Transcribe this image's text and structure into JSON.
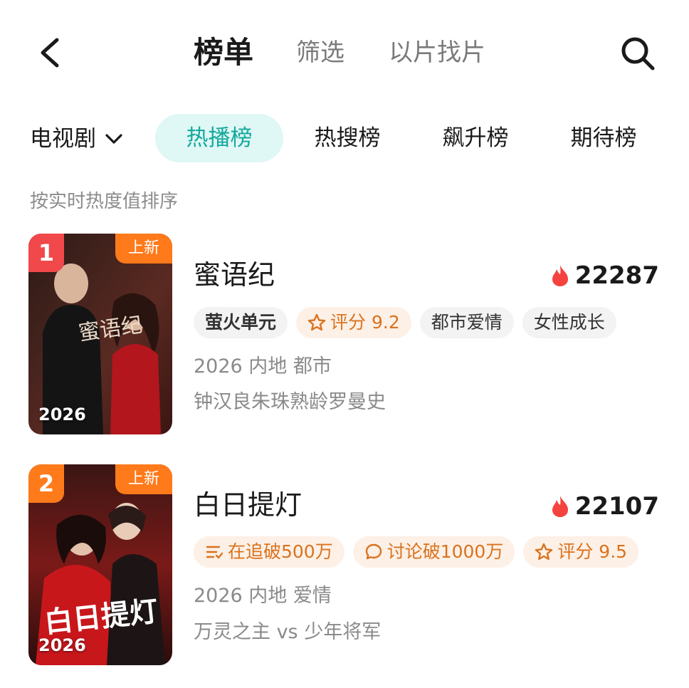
{
  "nav": {
    "tabs": [
      {
        "label": "榜单"
      },
      {
        "label": "筛选"
      },
      {
        "label": "以片找片"
      }
    ]
  },
  "category": {
    "selected": "电视剧",
    "tabs": [
      {
        "label": "热播榜"
      },
      {
        "label": "热搜榜"
      },
      {
        "label": "飙升榜"
      },
      {
        "label": "期待榜"
      }
    ]
  },
  "sort_hint": "按实时热度值排序",
  "items": [
    {
      "rank": "1",
      "badge": "上新",
      "poster_year": "2026",
      "poster_text": "蜜语纪",
      "title": "蜜语纪",
      "heat": "22287",
      "platform": "萤火单元",
      "tags": [
        "评分 9.2",
        "都市爱情",
        "女性成长"
      ],
      "meta": "2026 内地 都市",
      "desc": "钟汉良朱珠熟龄罗曼史"
    },
    {
      "rank": "2",
      "badge": "上新",
      "poster_year": "2026",
      "poster_text": "白日提灯",
      "title": "白日提灯",
      "heat": "22107",
      "tags": [
        "在追破500万",
        "讨论破1000万",
        "评分 9.5"
      ],
      "meta": "2026 内地 爱情",
      "desc": "万灵之主 vs 少年将军"
    }
  ],
  "colors": {
    "accent": "#13a99c",
    "accent_bg": "#dff7f5",
    "rank1": "#f0484b",
    "rank2": "#ff7a1a",
    "new_badge": "#ff7a1a",
    "heat_icon": "#f5433f",
    "orange_text": "#d9731f"
  },
  "icons": [
    "back-arrow-icon",
    "search-icon",
    "chevron-down-icon",
    "flame-icon",
    "star-icon",
    "list-icon",
    "comment-icon"
  ]
}
